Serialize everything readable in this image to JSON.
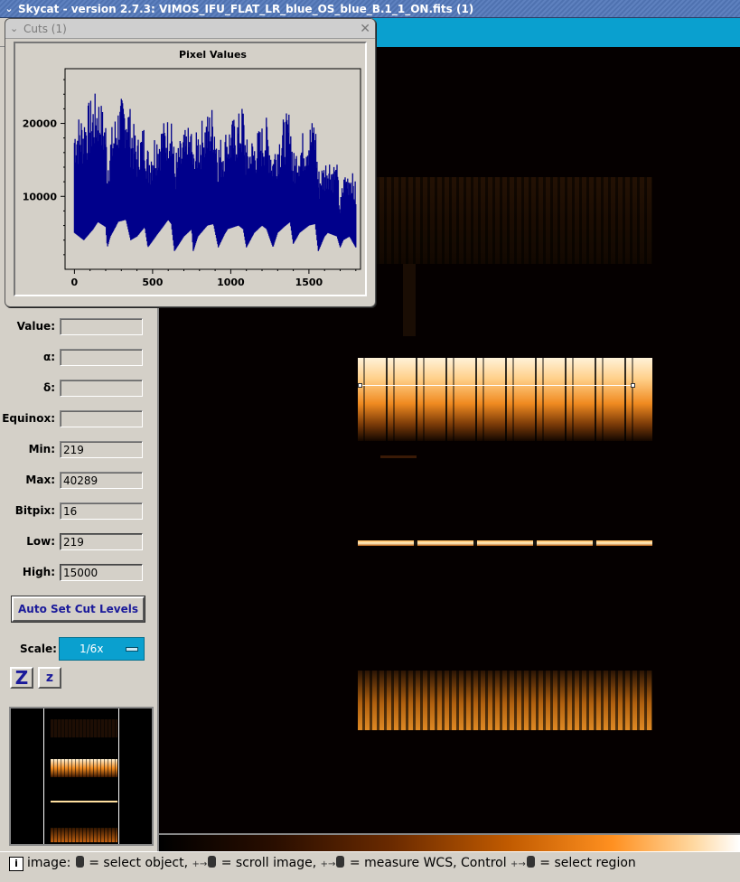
{
  "window": {
    "title": "Skycat - version 2.7.3: VIMOS_IFU_FLAT_LR_blue_OS_blue_B.1_1_ON.fits (1)"
  },
  "cuts_dialog": {
    "title": "Cuts (1)",
    "close_glyph": "✕",
    "chevron_glyph": "❯"
  },
  "chart_data": {
    "type": "line",
    "title": "Pixel Values",
    "xlabel": "",
    "ylabel": "",
    "xlim": [
      -60,
      1830
    ],
    "ylim": [
      0,
      27500
    ],
    "x_ticks": [
      0,
      500,
      1000,
      1500
    ],
    "y_ticks": [
      10000,
      20000
    ],
    "series": [
      {
        "color": "#00008b",
        "x": [
          0,
          60,
          120,
          150,
          200,
          210,
          230,
          280,
          330,
          360,
          400,
          450,
          470,
          520,
          600,
          620,
          640,
          700,
          750,
          760,
          790,
          850,
          890,
          920,
          960,
          980,
          1050,
          1080,
          1100,
          1150,
          1200,
          1230,
          1270,
          1300,
          1340,
          1380,
          1400,
          1440,
          1500,
          1540,
          1560,
          1600,
          1620,
          1680,
          1700,
          1720,
          1760,
          1800
        ],
        "min": [
          5000,
          4000,
          5500,
          6500,
          5800,
          3000,
          4500,
          6500,
          6800,
          4000,
          4500,
          5800,
          3000,
          4500,
          6800,
          6200,
          2500,
          4500,
          5500,
          2500,
          4500,
          6000,
          6200,
          3000,
          4800,
          5500,
          6000,
          5500,
          3000,
          5000,
          6000,
          5500,
          3000,
          5000,
          5800,
          6500,
          3500,
          5000,
          6000,
          6200,
          2500,
          4500,
          5000,
          4500,
          3000,
          4000,
          4500,
          3000
        ],
        "max": [
          21000,
          22000,
          24000,
          24500,
          21000,
          16000,
          19000,
          23000,
          24500,
          22000,
          18000,
          20500,
          17000,
          19500,
          21000,
          23000,
          16000,
          19000,
          20000,
          16500,
          20000,
          21500,
          23000,
          18000,
          19000,
          20000,
          21500,
          23000,
          18000,
          18500,
          20000,
          21000,
          17000,
          19000,
          21000,
          22000,
          16000,
          18500,
          20000,
          21500,
          14000,
          15000,
          16000,
          14500,
          9500,
          13000,
          14500,
          12000
        ]
      }
    ]
  },
  "panel": {
    "value_label": "Value:",
    "value": "",
    "alpha_label": "α:",
    "alpha": "",
    "delta_label": "δ:",
    "delta": "",
    "equinox_label": "Equinox:",
    "equinox": "",
    "min_label": "Min:",
    "min": "219",
    "max_label": "Max:",
    "max": "40289",
    "bitpix_label": "Bitpix:",
    "bitpix": "16",
    "low_label": "Low:",
    "low": "219",
    "high_label": "High:",
    "high": "15000",
    "auto_set_label": "Auto Set Cut Levels",
    "scale_label": "Scale:",
    "scale_value": "1/6x",
    "zoom_in_glyph": "Z",
    "zoom_out_glyph": "z"
  },
  "status": {
    "info_glyph": "i",
    "p1": "image:",
    "p2": "= select object,",
    "p3": "= scroll image,",
    "p4": "= measure WCS, Control",
    "p5": "= select region",
    "arrow": "+→"
  }
}
